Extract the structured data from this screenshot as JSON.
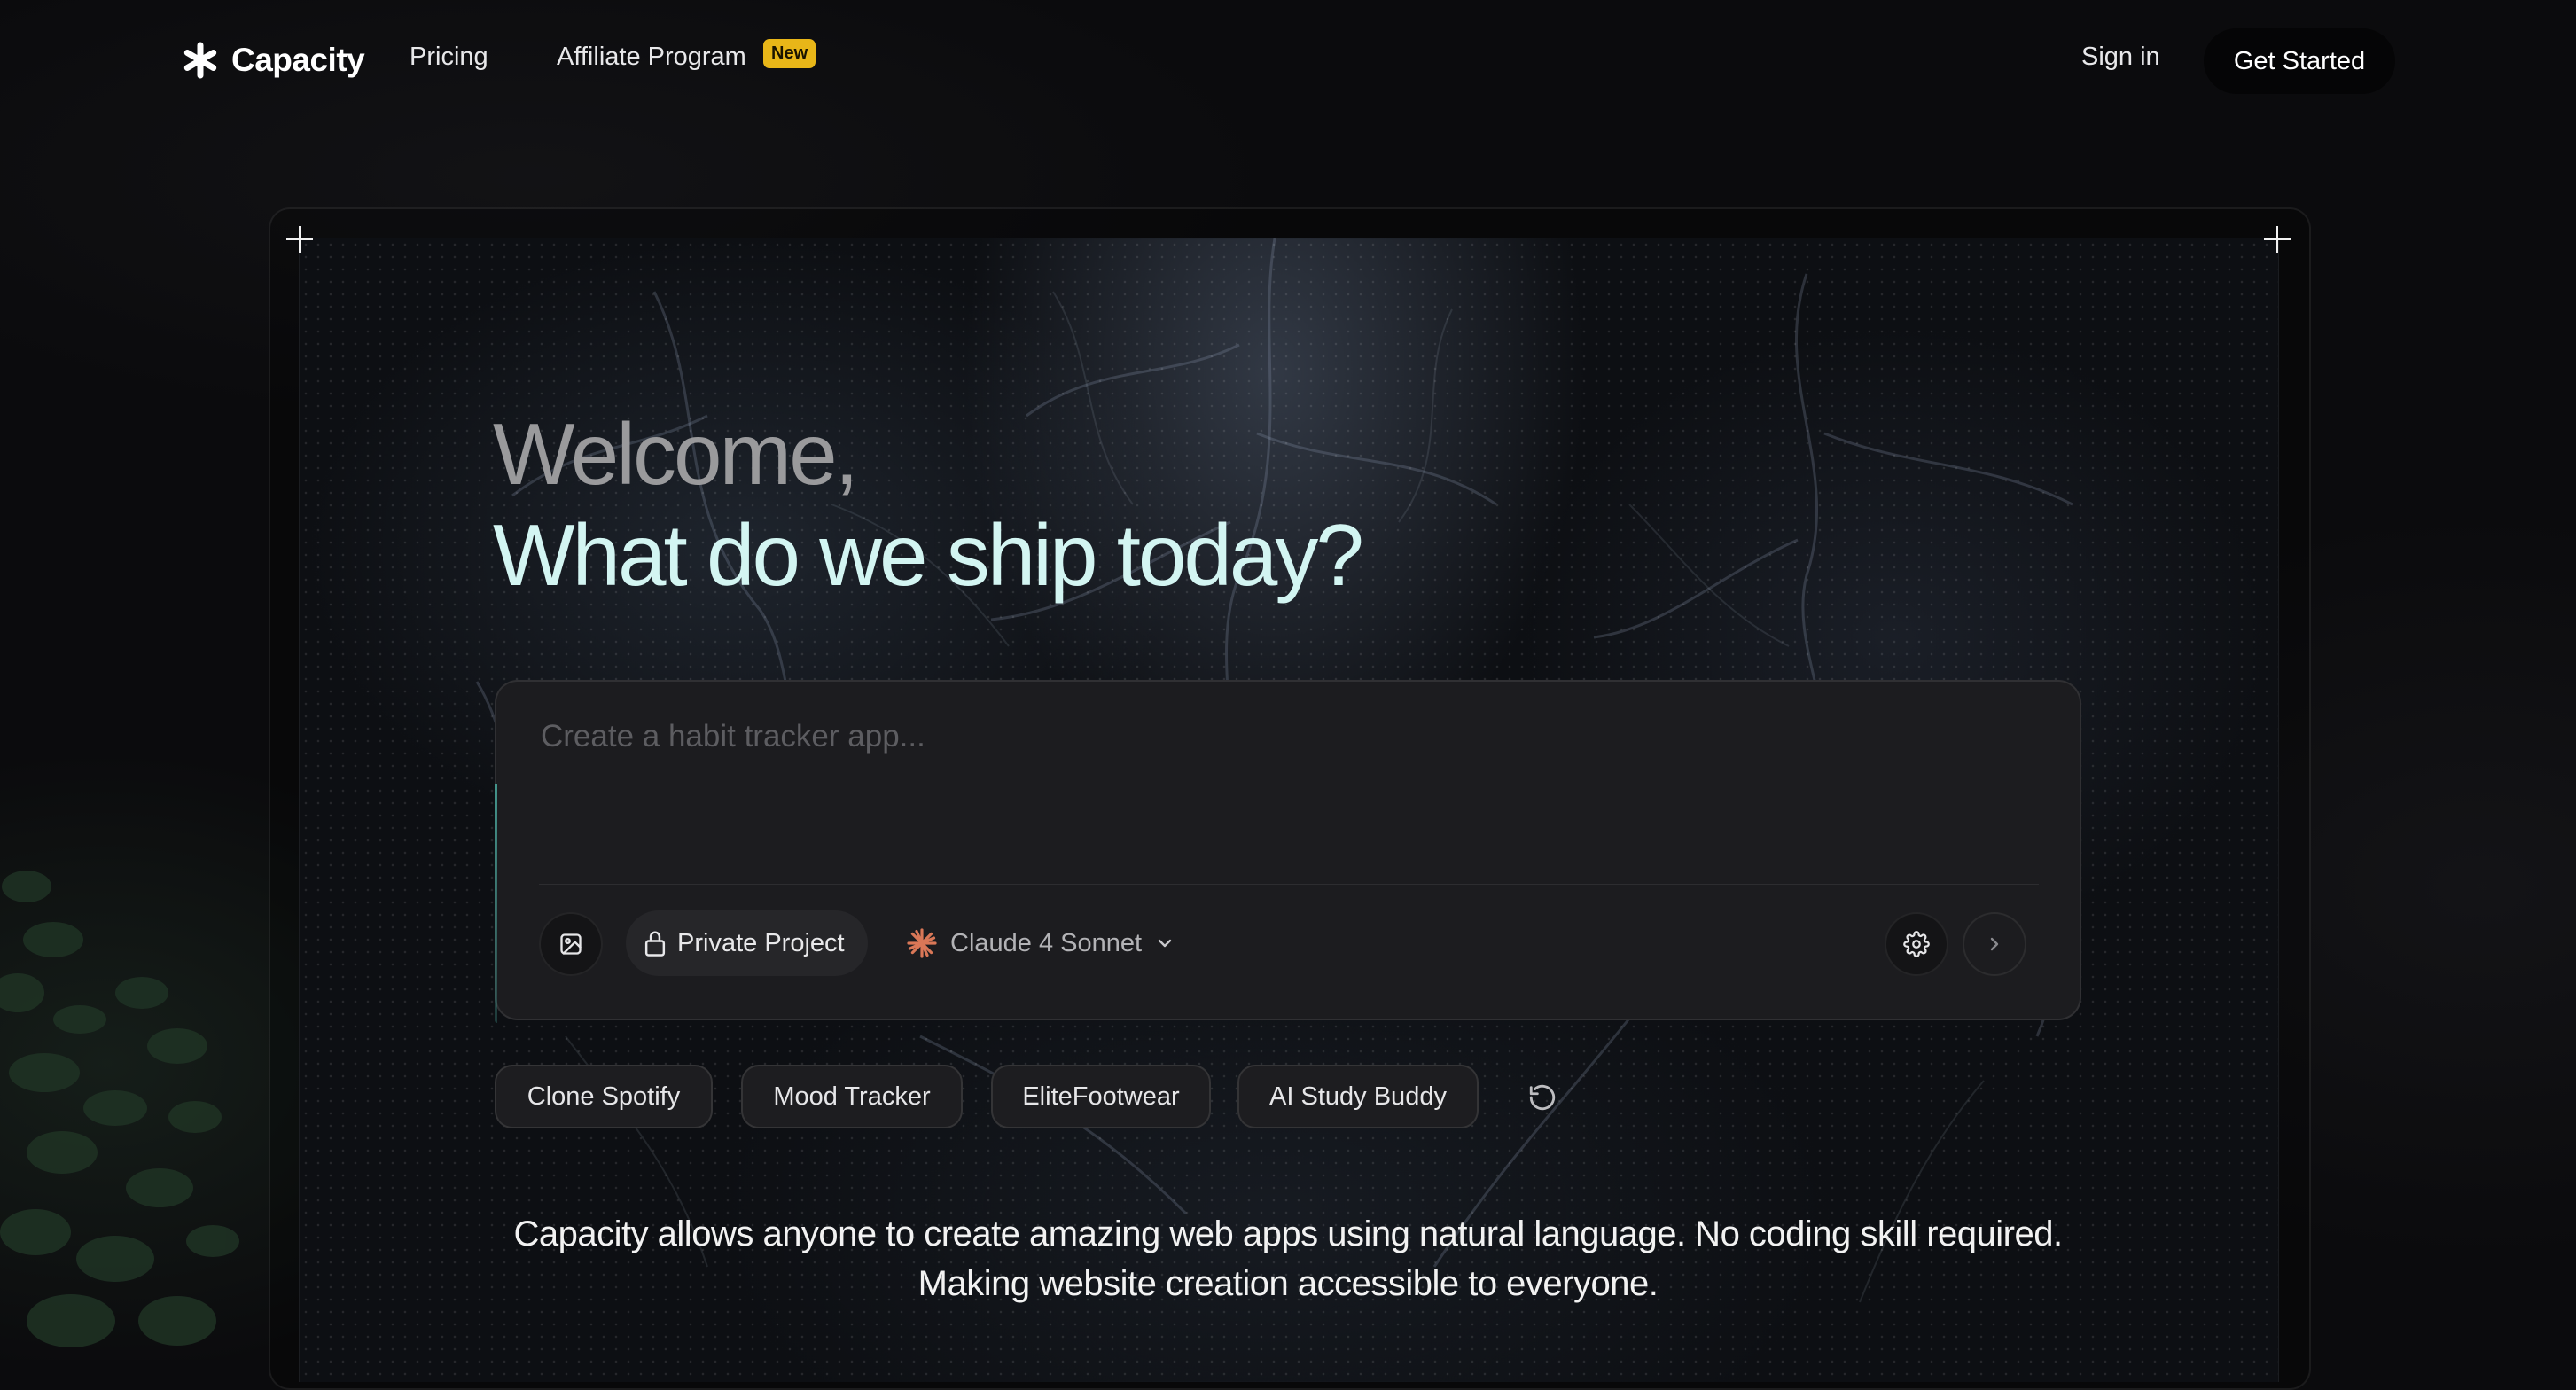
{
  "nav": {
    "brand": "Capacity",
    "links": [
      "Pricing",
      "Affiliate Program"
    ],
    "badge": "New",
    "sign_in": "Sign in",
    "get_started": "Get Started"
  },
  "hero": {
    "welcome": "Welcome,",
    "headline": "What do we ship today?"
  },
  "prompt": {
    "placeholder": "Create a habit tracker app...",
    "value": "",
    "private_project": "Private Project",
    "model": "Claude 4 Sonnet"
  },
  "suggestions": [
    "Clone Spotify",
    "Mood Tracker",
    "EliteFootwear",
    "AI Study Buddy"
  ],
  "tagline": {
    "line1": "Capacity allows anyone to create amazing web apps using natural language. No coding skill required.",
    "line2": "Making website creation accessible to everyone."
  },
  "colors": {
    "background": "#0b0b0d",
    "headline": "#d3f5f2",
    "welcome": "#9a9a9c",
    "badge": "#e8b618",
    "model_icon": "#d97757",
    "prompt_box": "#1c1c1f"
  },
  "icons": {
    "logo": "asterisk-icon",
    "image": "image-icon",
    "lock": "lock-icon",
    "model": "sparkle-icon",
    "dropdown": "chevron-down-icon",
    "settings": "gear-icon",
    "send": "chevron-right-icon",
    "refresh": "refresh-icon"
  }
}
